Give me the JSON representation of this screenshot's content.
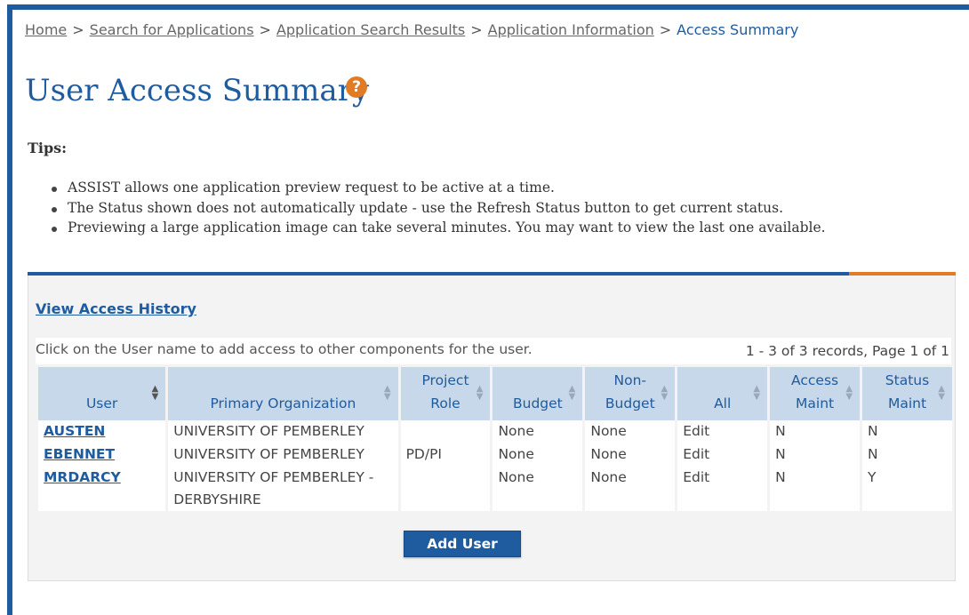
{
  "breadcrumb": {
    "items": [
      "Home",
      "Search for Applications",
      "Application Search Results",
      "Application Information"
    ],
    "separator": ">",
    "current": "Access Summary"
  },
  "page": {
    "title": "User Access Summary",
    "help_glyph": "?"
  },
  "tips": {
    "heading": "Tips:",
    "items": [
      "ASSIST allows one application preview request to be active at a time.",
      "The Status shown does not automatically update - use the Refresh Status button to get current status.",
      "Previewing a large application image can take several minutes.  You may want to view the last one available."
    ]
  },
  "panel": {
    "history_link": "View Access History",
    "instruction": "Click on the User name to add access to other components for the user.",
    "record_count": "1 - 3 of 3 records, Page 1 of 1",
    "add_user_label": "Add User"
  },
  "table": {
    "headers": [
      [
        "User"
      ],
      [
        "Primary Organization"
      ],
      [
        "Project",
        "Role"
      ],
      [
        "Budget"
      ],
      [
        "Non-",
        "Budget"
      ],
      [
        "All"
      ],
      [
        "Access",
        "Maint"
      ],
      [
        "Status",
        "Maint"
      ]
    ],
    "rows": [
      {
        "user": "AUSTEN",
        "org": [
          "UNIVERSITY OF PEMBERLEY"
        ],
        "role": "",
        "budget": "None",
        "non_budget": "None",
        "all": "Edit",
        "access_maint": "N",
        "status_maint": "N"
      },
      {
        "user": "EBENNET",
        "org": [
          "UNIVERSITY OF PEMBERLEY"
        ],
        "role": "PD/PI",
        "budget": "None",
        "non_budget": "None",
        "all": "Edit",
        "access_maint": "N",
        "status_maint": "N"
      },
      {
        "user": "MRDARCY",
        "org": [
          "UNIVERSITY OF PEMBERLEY -",
          "DERBYSHIRE"
        ],
        "role": "",
        "budget": "None",
        "non_budget": "None",
        "all": "Edit",
        "access_maint": "N",
        "status_maint": "Y"
      }
    ]
  },
  "colors": {
    "brand_blue": "#1f5b9f",
    "accent_orange": "#e07b26",
    "header_fill": "#c7d8ea"
  }
}
